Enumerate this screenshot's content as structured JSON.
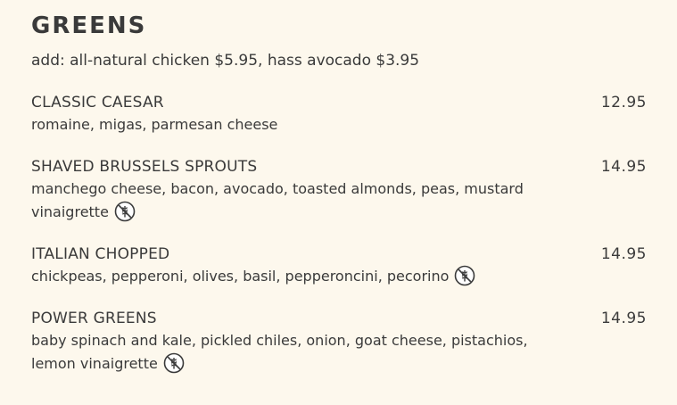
{
  "section": {
    "title": "GREENS",
    "addons": "add: all-natural chicken $5.95, hass avocado $3.95"
  },
  "items": [
    {
      "name": "CLASSIC CAESAR",
      "price": "12.95",
      "desc": "romaine, migas, parmesan cheese",
      "icon": ""
    },
    {
      "name": "SHAVED BRUSSELS SPROUTS",
      "price": "14.95",
      "desc": "manchego cheese, bacon, avocado, toasted almonds, peas, mustard vinaigrette",
      "icon": "gluten-free-icon"
    },
    {
      "name": "ITALIAN CHOPPED",
      "price": "14.95",
      "desc": "chickpeas, pepperoni, olives, basil, pepperoncini, pecorino",
      "icon": "gluten-free-icon"
    },
    {
      "name": "POWER GREENS",
      "price": "14.95",
      "desc": "baby spinach and kale, pickled chiles, onion, goat cheese, pistachios, lemon vinaigrette",
      "icon": "gluten-free-icon"
    }
  ],
  "colors": {
    "background": "#fdf8ed",
    "text": "#3a3a3a"
  }
}
